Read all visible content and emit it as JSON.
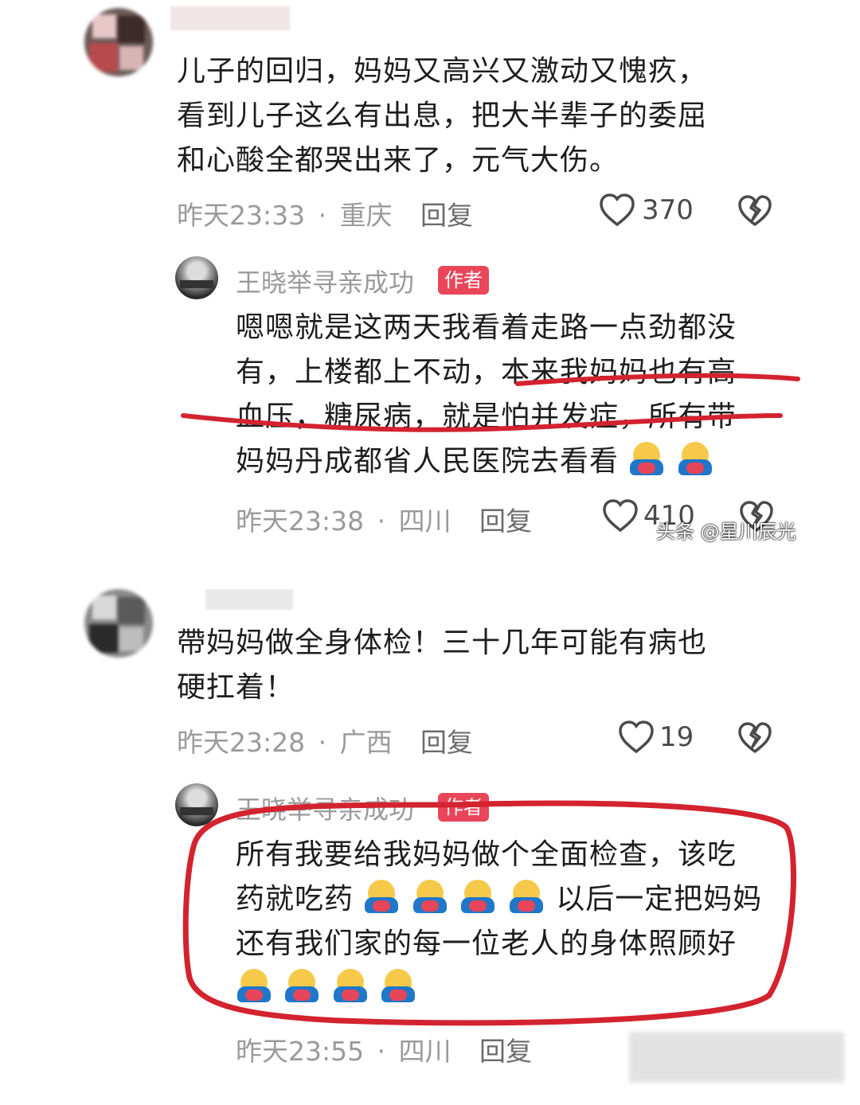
{
  "comments": [
    {
      "text_lines": [
        "儿子的回归，妈妈又高兴又激动又愧疚，",
        "看到儿子这么有出息，把大半辈子的委屈",
        "和心酸全都哭出来了，元气大伤。"
      ],
      "time": "昨天23:33",
      "dot": "·",
      "location": "重庆",
      "reply_label": "回复",
      "likes": "370"
    },
    {
      "text_lines": [
        "帶妈妈做全身体检！三十几年可能有病也",
        "硬扛着！"
      ],
      "time": "昨天23:28",
      "dot": "·",
      "location": "广西",
      "reply_label": "回复",
      "likes": "19"
    }
  ],
  "replies": [
    {
      "author": "王晓举寻亲成功",
      "tag": "作者",
      "text_lines": [
        "嗯嗯就是这两天我看着走路一点劲都没",
        "有，上楼都上不动，本来我妈妈也有高",
        "血压，糖尿病，就是怕并发症，所有带",
        "妈妈丹成都省人民医院去看看"
      ],
      "time": "昨天23:38",
      "dot": "·",
      "location": "四川",
      "reply_label": "回复",
      "likes": "410"
    },
    {
      "author": "王晓举寻亲成功",
      "tag": "作者",
      "text_lines": [
        "所有我要给我妈妈做个全面检查，该吃",
        "药就吃药",
        "以后一定把妈妈",
        "还有我们家的每一位老人的身体照顾好"
      ],
      "time": "昨天23:55",
      "dot": "·",
      "location": "四川",
      "reply_label": "回复"
    }
  ],
  "watermark": "头条 @星川辰光",
  "colors": {
    "annotation_red": "#d3232f",
    "author_tag": "#e9465a"
  },
  "icons": [
    "heart-icon",
    "heart-broken-icon",
    "hug-emoji"
  ]
}
